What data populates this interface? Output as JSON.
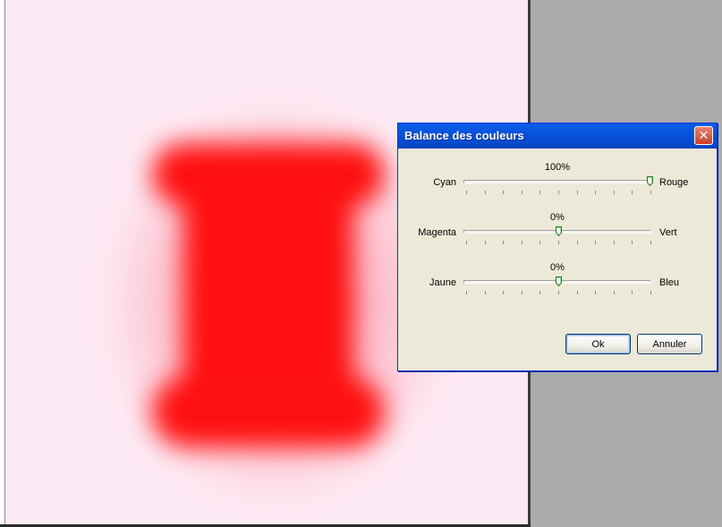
{
  "dialog": {
    "title": "Balance des couleurs",
    "sliders": [
      {
        "percent_label": "100%",
        "left_label": "Cyan",
        "right_label": "Rouge",
        "value": 100
      },
      {
        "percent_label": "0%",
        "left_label": "Magenta",
        "right_label": "Vert",
        "value": 0
      },
      {
        "percent_label": "0%",
        "left_label": "Jaune",
        "right_label": "Bleu",
        "value": 0
      }
    ],
    "ok_label": "Ok",
    "cancel_label": "Annuler"
  },
  "colors": {
    "titlebar": "#0a5ee8",
    "dialog_bg": "#ece9d8",
    "canvas_bg": "#fde9f3",
    "shape": "#ff1010",
    "workspace": "#ababab"
  }
}
